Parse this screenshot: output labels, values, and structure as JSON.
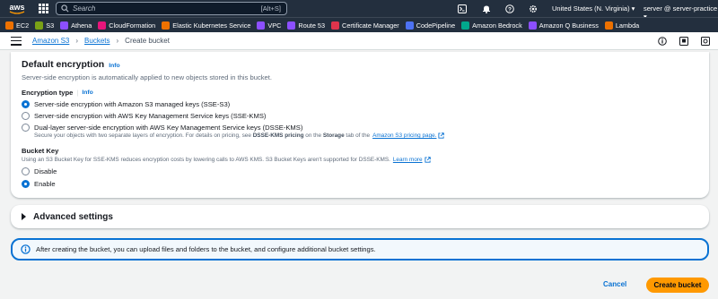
{
  "topbar": {
    "logo_text": "aws",
    "search_placeholder": "Search",
    "search_shortcut": "[Alt+S]",
    "region": "United States (N. Virginia) ▾",
    "account": "server @ server-practice ▾"
  },
  "favorites": [
    {
      "label": "EC2",
      "color": "#ed7100"
    },
    {
      "label": "S3",
      "color": "#7aa116"
    },
    {
      "label": "Athena",
      "color": "#8c4fff"
    },
    {
      "label": "CloudFormation",
      "color": "#e7157b"
    },
    {
      "label": "Elastic Kubernetes Service",
      "color": "#ed7100"
    },
    {
      "label": "VPC",
      "color": "#8c4fff"
    },
    {
      "label": "Route 53",
      "color": "#8c4fff"
    },
    {
      "label": "Certificate Manager",
      "color": "#dd344c"
    },
    {
      "label": "CodePipeline",
      "color": "#4d72f3"
    },
    {
      "label": "Amazon Bedrock",
      "color": "#01a88d"
    },
    {
      "label": "Amazon Q Business",
      "color": "#8c4fff"
    },
    {
      "label": "Lambda",
      "color": "#ed7100"
    }
  ],
  "breadcrumb": {
    "s3": "Amazon S3",
    "buckets": "Buckets",
    "current": "Create bucket"
  },
  "encryption": {
    "title": "Default encryption",
    "info": "Info",
    "description": "Server-side encryption is automatically applied to new objects stored in this bucket.",
    "type_label": "Encryption type",
    "type_info": "Info",
    "options": [
      {
        "label": "Server-side encryption with Amazon S3 managed keys (SSE-S3)",
        "selected": true
      },
      {
        "label": "Server-side encryption with AWS Key Management Service keys (SSE-KMS)",
        "selected": false
      },
      {
        "label": "Dual-layer server-side encryption with AWS Key Management Service keys (DSSE-KMS)",
        "selected": false
      }
    ],
    "dsse_note_a": "Secure your objects with two separate layers of encryption. For details on pricing, see",
    "dsse_note_b": "DSSE-KMS pricing",
    "dsse_note_c": "on the",
    "dsse_note_d": "Storage",
    "dsse_note_e": "tab of the",
    "dsse_note_link": "Amazon S3 pricing page."
  },
  "bucket_key": {
    "label": "Bucket Key",
    "description": "Using an S3 Bucket Key for SSE-KMS reduces encryption costs by lowering calls to AWS KMS. S3 Bucket Keys aren't supported for DSSE-KMS.",
    "learn_more": "Learn more",
    "options": [
      {
        "label": "Disable",
        "selected": false
      },
      {
        "label": "Enable",
        "selected": true
      }
    ]
  },
  "advanced": {
    "title": "Advanced settings"
  },
  "alert": {
    "text": "After creating the bucket, you can upload files and folders to the bucket, and configure additional bucket settings."
  },
  "footer": {
    "cancel": "Cancel",
    "create": "Create bucket"
  }
}
